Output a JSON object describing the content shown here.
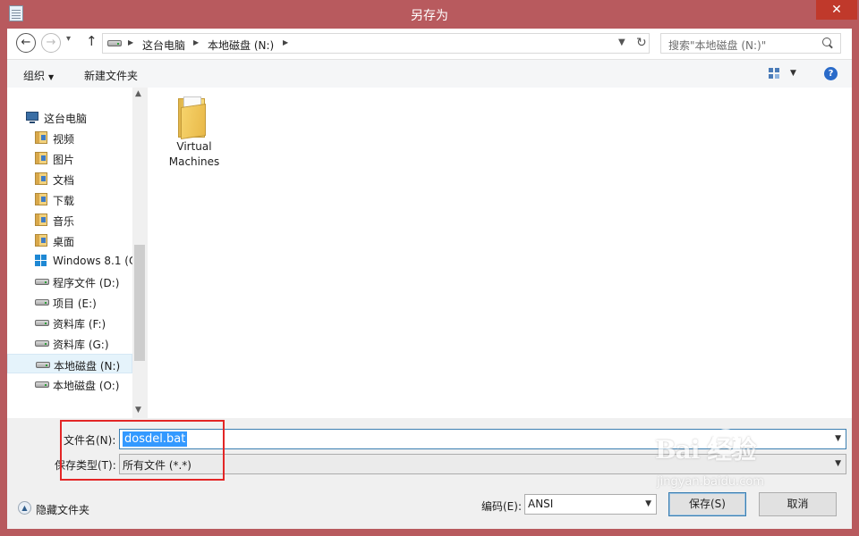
{
  "window": {
    "title": "另存为",
    "close_glyph": "✕"
  },
  "address": {
    "crumbs": [
      "这台电脑",
      "本地磁盘 (N:)"
    ],
    "search_placeholder": "搜索\"本地磁盘 (N:)\""
  },
  "toolbar": {
    "organize": "组织",
    "new_folder": "新建文件夹",
    "help": "?"
  },
  "nav": {
    "items": [
      {
        "label": "这台电脑",
        "icon": "computer-icon"
      },
      {
        "label": "视频",
        "icon": "videos-library-icon"
      },
      {
        "label": "图片",
        "icon": "pictures-library-icon"
      },
      {
        "label": "文档",
        "icon": "documents-library-icon"
      },
      {
        "label": "下载",
        "icon": "downloads-library-icon"
      },
      {
        "label": "音乐",
        "icon": "music-library-icon"
      },
      {
        "label": "桌面",
        "icon": "desktop-library-icon"
      },
      {
        "label": "Windows 8.1 (C",
        "icon": "windows-drive-icon"
      },
      {
        "label": "程序文件 (D:)",
        "icon": "drive-icon"
      },
      {
        "label": "项目 (E:)",
        "icon": "drive-icon"
      },
      {
        "label": "资料库 (F:)",
        "icon": "drive-icon"
      },
      {
        "label": "资料库 (G:)",
        "icon": "drive-icon"
      },
      {
        "label": "本地磁盘 (N:)",
        "icon": "drive-icon",
        "selected": true
      },
      {
        "label": "本地磁盘 (O:)",
        "icon": "drive-icon"
      }
    ]
  },
  "content": {
    "items": [
      {
        "label_line1": "Virtual",
        "label_line2": "Machines",
        "icon": "folder-icon"
      }
    ]
  },
  "form": {
    "filename_label": "文件名(N):",
    "filename_value": "dosdel.bat",
    "type_label": "保存类型(T):",
    "type_value": "所有文件  (*.*)",
    "encoding_label": "编码(E):",
    "encoding_value": "ANSI"
  },
  "footer": {
    "hide_folders": "隐藏文件夹",
    "save_button": "保存(S)",
    "cancel_button": "取消"
  },
  "watermark": {
    "brand": "Bai  经验",
    "sub": "jingyan.baidu.com"
  },
  "colors": {
    "title_bar": "#b85a5e",
    "selection": "#3399ff",
    "highlight_box": "#e32626"
  }
}
